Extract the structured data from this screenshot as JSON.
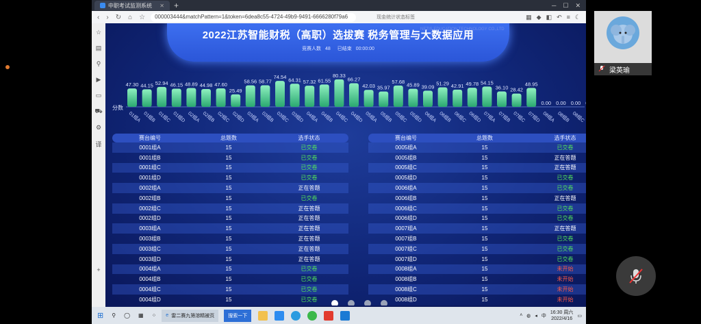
{
  "browser": {
    "tab_title": "中职考试监测系统",
    "url": "000003444&matchPattern=1&token=6dea8c55-4724-49b9-9491-6666280f79a6",
    "overlay_text": "现金统计状态标签"
  },
  "page": {
    "title": "2022江苏智能财税（高职）选拔赛 税务管理与大数据应用",
    "company_overlay": "NETIS EDUCATION TECHNOLOGY CO.,LTD",
    "status_label": "竞赛人数",
    "status_count": "48",
    "status_state": "已结束",
    "status_time": "00:00:00"
  },
  "chart_data": {
    "type": "bar",
    "ylabel": "分数",
    "categories": [
      "01组A",
      "01组B",
      "01组C",
      "01组D",
      "02组A",
      "02组B",
      "02组C",
      "02组D",
      "03组A",
      "03组B",
      "03组C",
      "03组D",
      "04组A",
      "04组B",
      "04组C",
      "04组D",
      "05组A",
      "05组B",
      "05组C",
      "05组D",
      "06组A",
      "06组B",
      "06组C",
      "06组D",
      "07组A",
      "07组B",
      "07组C",
      "07组D",
      "08组A",
      "08组B",
      "08组C",
      "08组D"
    ],
    "values": [
      47.3,
      44.15,
      52.94,
      46.15,
      48.89,
      44.98,
      47.6,
      25.49,
      58.56,
      58.77,
      74.54,
      64.31,
      57.32,
      61.55,
      80.33,
      66.27,
      42.03,
      35.97,
      57.68,
      45.89,
      39.09,
      51.29,
      42.91,
      49.78,
      54.15,
      36.1,
      28.42,
      48.95,
      0.0,
      0.0,
      0.0,
      0.0
    ],
    "value_labels": [
      "47.30",
      "44.15",
      "52.94",
      "46.15",
      "48.89",
      "44.98",
      "47.60",
      "25.49",
      "58.56",
      "58.77",
      "74.54",
      "64.31",
      "57.32",
      "61.55",
      "80.33",
      "66.27",
      "42.03",
      "35.97",
      "57.68",
      "45.89",
      "39.09",
      "51.29",
      "42.91",
      "49.78",
      "54.15",
      "36.10",
      "28.42",
      "48.95",
      "0.00",
      "0.00",
      "0.00",
      "0.00"
    ]
  },
  "table": {
    "headers": [
      "赛台编号",
      "总题数",
      "选手状态"
    ],
    "left": [
      {
        "id": "0001组A",
        "total": "15",
        "status": "已交卷",
        "kind": "ok"
      },
      {
        "id": "0001组B",
        "total": "15",
        "status": "已交卷",
        "kind": "ok"
      },
      {
        "id": "0001组C",
        "total": "15",
        "status": "已交卷",
        "kind": "ok"
      },
      {
        "id": "0001组D",
        "total": "15",
        "status": "已交卷",
        "kind": "ok"
      },
      {
        "id": "0002组A",
        "total": "15",
        "status": "正在答题",
        "kind": "ans"
      },
      {
        "id": "0002组B",
        "total": "15",
        "status": "已交卷",
        "kind": "ok"
      },
      {
        "id": "0002组C",
        "total": "15",
        "status": "正在答题",
        "kind": "ans"
      },
      {
        "id": "0002组D",
        "total": "15",
        "status": "正在答题",
        "kind": "ans"
      },
      {
        "id": "0003组A",
        "total": "15",
        "status": "正在答题",
        "kind": "ans"
      },
      {
        "id": "0003组B",
        "total": "15",
        "status": "正在答题",
        "kind": "ans"
      },
      {
        "id": "0003组C",
        "total": "15",
        "status": "正在答题",
        "kind": "ans"
      },
      {
        "id": "0003组D",
        "total": "15",
        "status": "正在答题",
        "kind": "ans"
      },
      {
        "id": "0004组A",
        "total": "15",
        "status": "已交卷",
        "kind": "ok"
      },
      {
        "id": "0004组B",
        "total": "15",
        "status": "已交卷",
        "kind": "ok"
      },
      {
        "id": "0004组C",
        "total": "15",
        "status": "已交卷",
        "kind": "ok"
      },
      {
        "id": "0004组D",
        "total": "15",
        "status": "已交卷",
        "kind": "ok"
      }
    ],
    "right": [
      {
        "id": "0005组A",
        "total": "15",
        "status": "已交卷",
        "kind": "ok"
      },
      {
        "id": "0005组B",
        "total": "15",
        "status": "正在答题",
        "kind": "ans"
      },
      {
        "id": "0005组C",
        "total": "15",
        "status": "正在答题",
        "kind": "ans"
      },
      {
        "id": "0005组D",
        "total": "15",
        "status": "已交卷",
        "kind": "ok"
      },
      {
        "id": "0006组A",
        "total": "15",
        "status": "已交卷",
        "kind": "ok"
      },
      {
        "id": "0006组B",
        "total": "15",
        "status": "正在答题",
        "kind": "ans"
      },
      {
        "id": "0006组C",
        "total": "15",
        "status": "已交卷",
        "kind": "ok"
      },
      {
        "id": "0006组D",
        "total": "15",
        "status": "已交卷",
        "kind": "ok"
      },
      {
        "id": "0007组A",
        "total": "15",
        "status": "正在答题",
        "kind": "ans"
      },
      {
        "id": "0007组B",
        "total": "15",
        "status": "已交卷",
        "kind": "ok"
      },
      {
        "id": "0007组C",
        "total": "15",
        "status": "已交卷",
        "kind": "ok"
      },
      {
        "id": "0007组D",
        "total": "15",
        "status": "已交卷",
        "kind": "ok"
      },
      {
        "id": "0008组A",
        "total": "15",
        "status": "未开始",
        "kind": "ns"
      },
      {
        "id": "0008组B",
        "total": "15",
        "status": "未开始",
        "kind": "ns"
      },
      {
        "id": "0008组C",
        "total": "15",
        "status": "未开始",
        "kind": "ns"
      },
      {
        "id": "0008组D",
        "total": "15",
        "status": "未开始",
        "kind": "ns"
      }
    ]
  },
  "taskbar": {
    "app1": "雷二赛九筛溶精被页",
    "app2": "搜索一下",
    "ime": "中",
    "time": "16:30 周六",
    "date": "2022/4/16"
  },
  "participant": {
    "name": "梁英瑜"
  },
  "colors": {
    "ok": "#54e65a",
    "answering": "#ffffff",
    "not_started": "#ff5a45",
    "bar_top": "#8ff0c0",
    "bar_bottom": "#2aa870"
  }
}
